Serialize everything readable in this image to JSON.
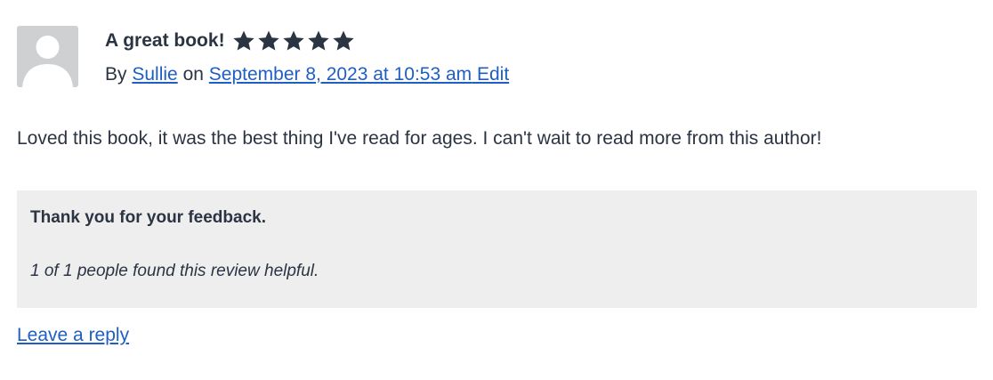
{
  "review": {
    "title": "A great book!",
    "rating": 5,
    "rating_max": 5,
    "star_icons": [
      "star-icon",
      "star-icon",
      "star-icon",
      "star-icon",
      "star-icon"
    ],
    "by_prefix": "By",
    "author": "Sullie",
    "on_word": "on",
    "date": "September 8, 2023 at 10:53 am",
    "edit_label": "Edit",
    "body": "Loved this book, it was the best thing I've read for ages. I can't wait to read more from this author!"
  },
  "feedback": {
    "thanks": "Thank you for your feedback.",
    "helpful": "1 of 1 people found this review helpful."
  },
  "reply_label": "Leave a reply",
  "colors": {
    "text": "#2b3443",
    "link": "#1f5fc4",
    "star": "#2b3443",
    "panel_bg": "#eeeeee",
    "avatar_bg": "#cfd0d1"
  }
}
